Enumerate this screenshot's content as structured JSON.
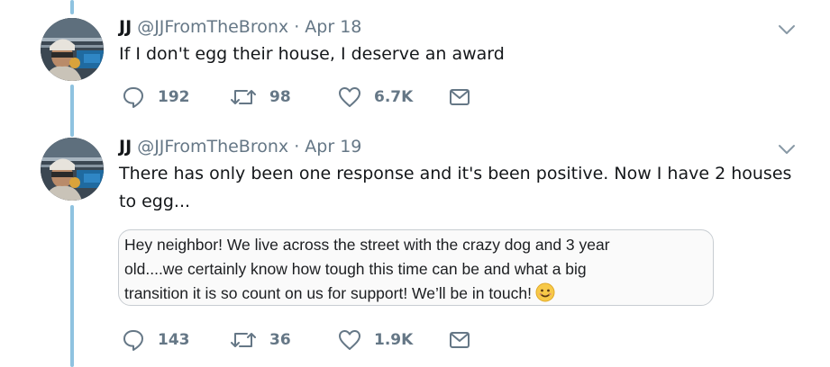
{
  "tweets": [
    {
      "name": "JJ",
      "handle": "@JJFromTheBronx",
      "separator": "·",
      "date": "Apr 18",
      "text": "If I don't egg their house, I deserve an award",
      "avatar_icon": "profile-photo",
      "actions": {
        "reply": "192",
        "retweet": "98",
        "like": "6.7K"
      }
    },
    {
      "name": "JJ",
      "handle": "@JJFromTheBronx",
      "separator": "·",
      "date": "Apr 19",
      "text": "There has only been one response and it's been positive. Now I have 2 houses to egg...",
      "avatar_icon": "profile-photo",
      "quote": {
        "lines": [
          "Hey neighbor! We live across the street with the crazy dog and 3 year",
          "old....we certainly know how tough this time can be and what a big",
          "transition it is so count on us for support! We’ll be in touch!"
        ],
        "emoji": "smiling-face-emoji"
      },
      "actions": {
        "reply": "143",
        "retweet": "36",
        "like": "1.9K"
      }
    }
  ],
  "icons": {
    "reply": "reply-icon",
    "retweet": "retweet-icon",
    "like": "heart-icon",
    "share": "message-icon",
    "menu": "chevron-down-icon"
  },
  "colors": {
    "thread_line": "#8fc3e0",
    "secondary_text": "#657786",
    "primary_text": "#14171a"
  }
}
